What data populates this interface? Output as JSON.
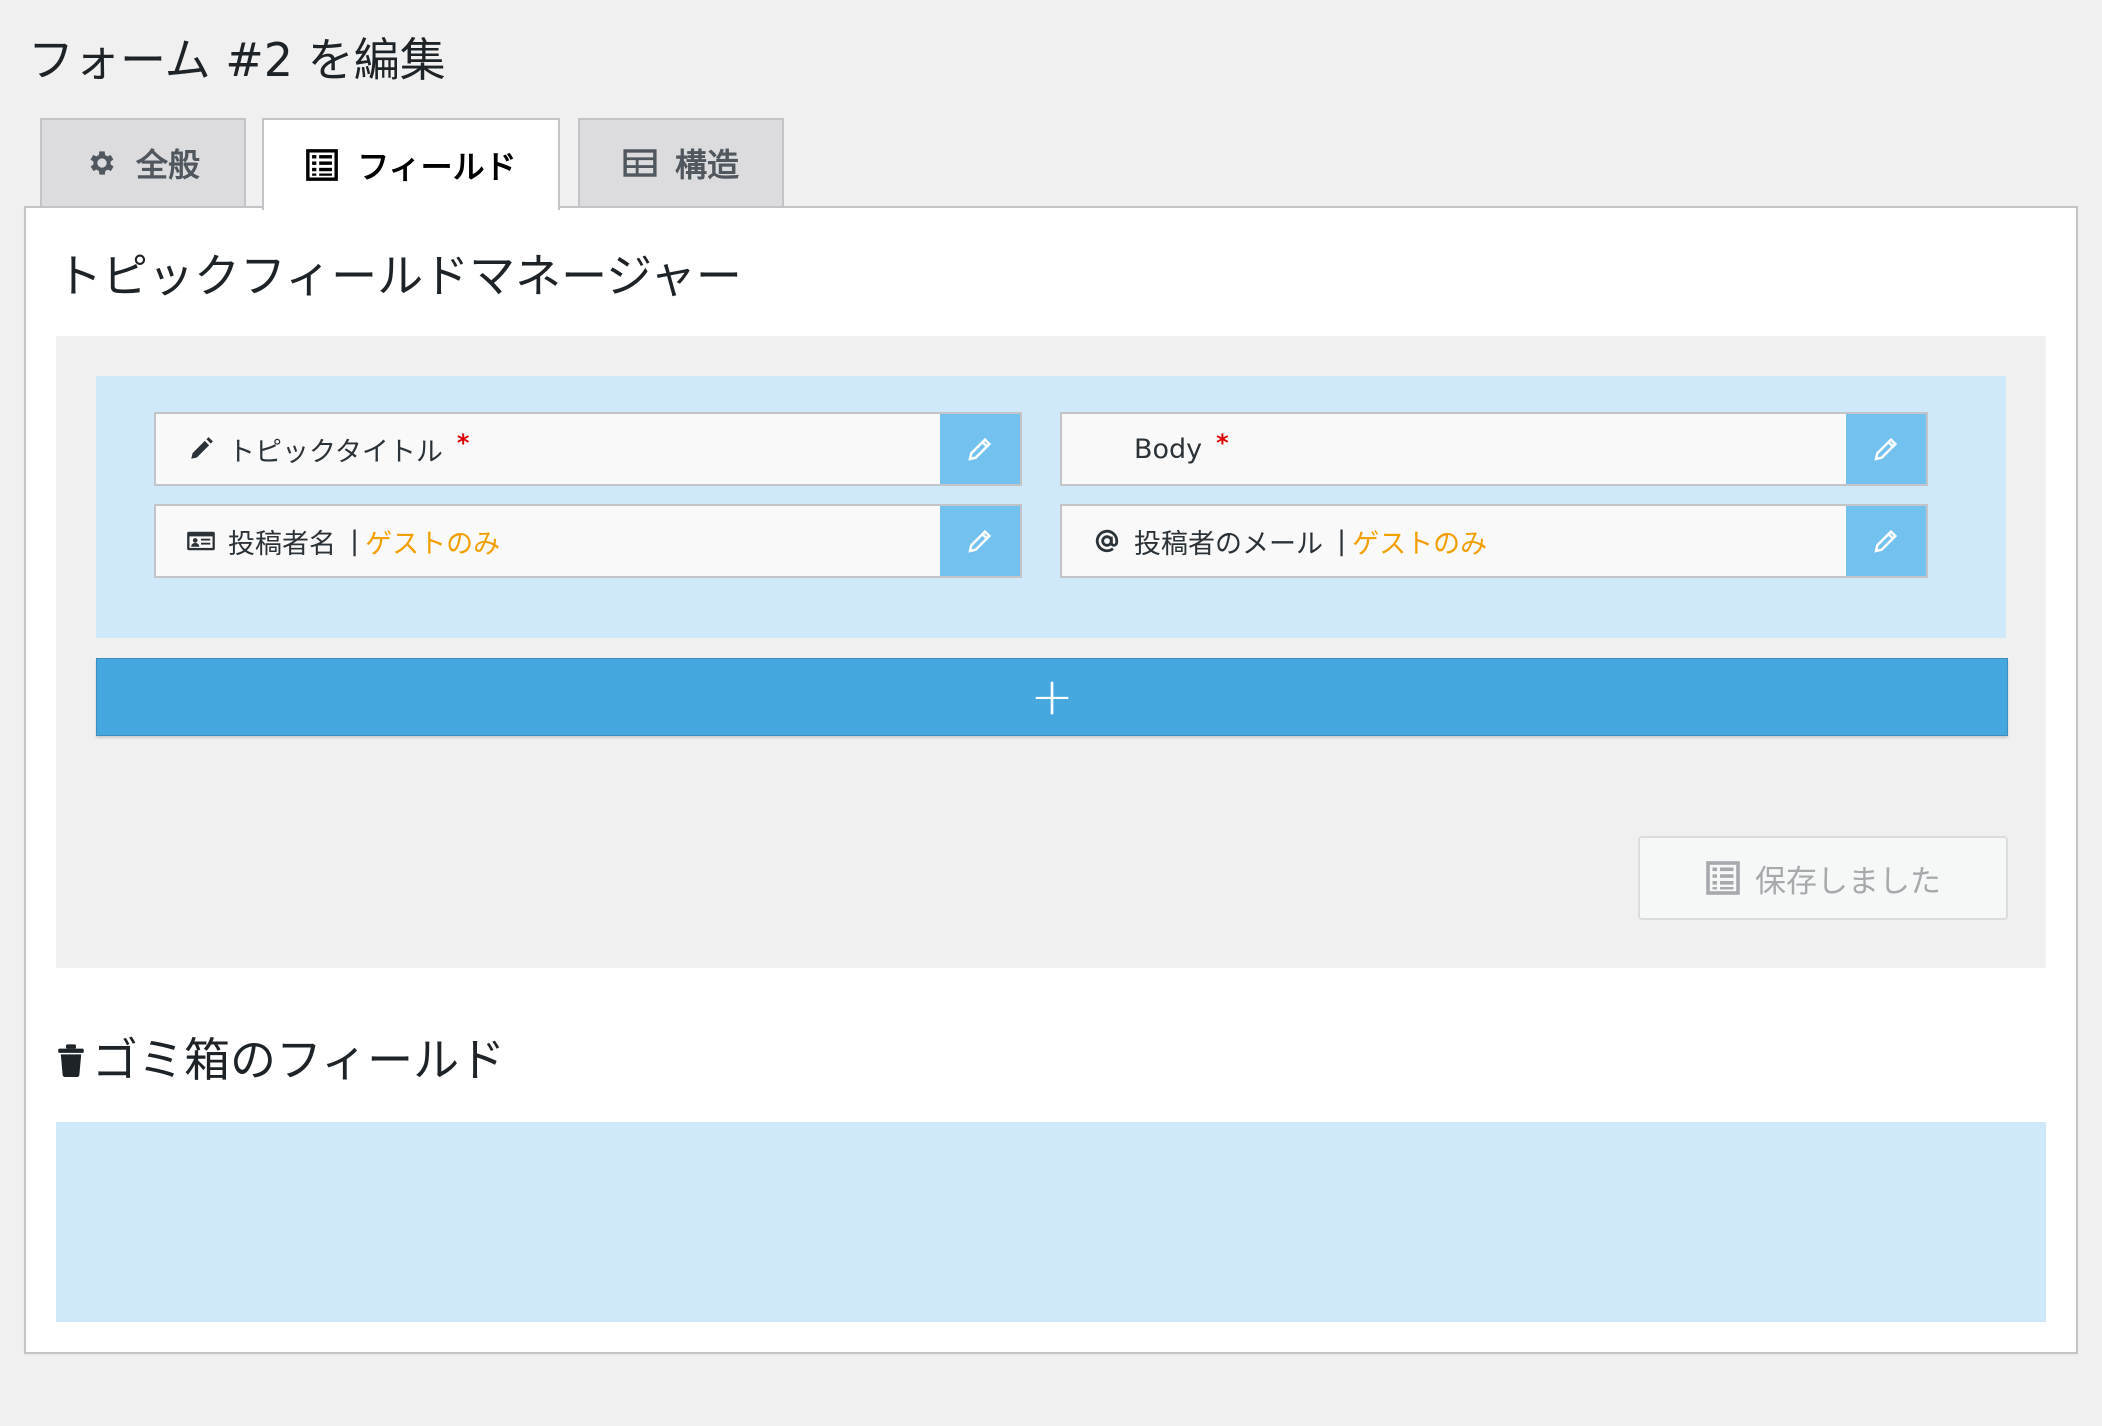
{
  "page": {
    "title": "フォーム #2 を編集"
  },
  "tabs": [
    {
      "label": "全般",
      "icon": "gear-icon"
    },
    {
      "label": "フィールド",
      "icon": "list-icon",
      "active": true
    },
    {
      "label": "構造",
      "icon": "table-icon"
    }
  ],
  "manager": {
    "title": "トピックフィールドマネージャー",
    "fields": [
      {
        "label": "トピックタイトル",
        "required": "*",
        "icon": "pencil-icon"
      },
      {
        "label": "Body",
        "required": "*",
        "icon": ""
      },
      {
        "label": "投稿者名",
        "separator": "|",
        "note": "ゲストのみ",
        "icon": "id-card-icon"
      },
      {
        "label": "投稿者のメール",
        "separator": "|",
        "note": "ゲストのみ",
        "icon": "at-icon"
      }
    ],
    "add_label": "+",
    "saved_label": "保存しました"
  },
  "trash": {
    "title": "ゴミ箱のフィールド",
    "icon": "trash-icon"
  },
  "colors": {
    "accent": "#46a7de",
    "field_area": "#cfe9fa",
    "edit_button": "#72c1ef",
    "guest_note": "#f0a000",
    "required": "#dd0000"
  }
}
